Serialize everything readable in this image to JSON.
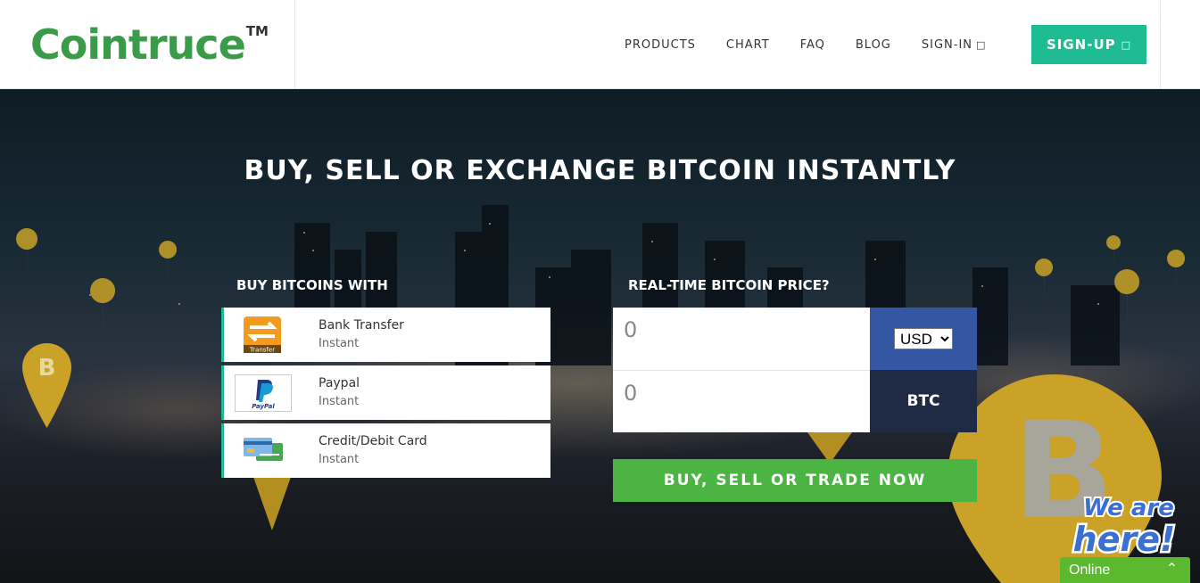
{
  "brand": {
    "name": "Cointruce",
    "tm": "TM"
  },
  "nav": {
    "items": [
      {
        "label": "PRODUCTS"
      },
      {
        "label": "CHART"
      },
      {
        "label": "FAQ"
      },
      {
        "label": "BLOG"
      },
      {
        "label": "SIGN-IN",
        "icon": "sign-in-icon"
      }
    ],
    "signup": {
      "label": "SIGN-UP",
      "icon": "user-add-icon"
    }
  },
  "hero": {
    "title": "BUY, SELL OR EXCHANGE BITCOIN INSTANTLY",
    "buy_with_label": "BUY BITCOINS WITH",
    "price_label": "REAL-TIME BITCOIN PRICE?",
    "payment_methods": [
      {
        "name": "Bank Transfer",
        "speed": "Instant",
        "icon": "bank-transfer-icon",
        "icon_text": "Transfer"
      },
      {
        "name": "Paypal",
        "speed": "Instant",
        "icon": "paypal-icon",
        "icon_text": "PayPal"
      },
      {
        "name": "Credit/Debit Card",
        "speed": "Instant",
        "icon": "credit-card-icon"
      }
    ],
    "converter": {
      "fiat_value": "0",
      "btc_value": "0",
      "fiat_currency": "USD",
      "currency_options": [
        "USD"
      ],
      "crypto_currency": "BTC"
    },
    "cta": "BUY, SELL OR TRADE NOW"
  },
  "chat": {
    "bubble_text_1": "We are",
    "bubble_text_2": "here!",
    "status": "Online"
  },
  "colors": {
    "brand_green": "#3a9b48",
    "teal": "#1fbc93",
    "cta_green": "#4bb443",
    "usd_blue": "#3556a3",
    "btc_navy": "#1f2a45",
    "coin_gold": "#c9a227"
  }
}
